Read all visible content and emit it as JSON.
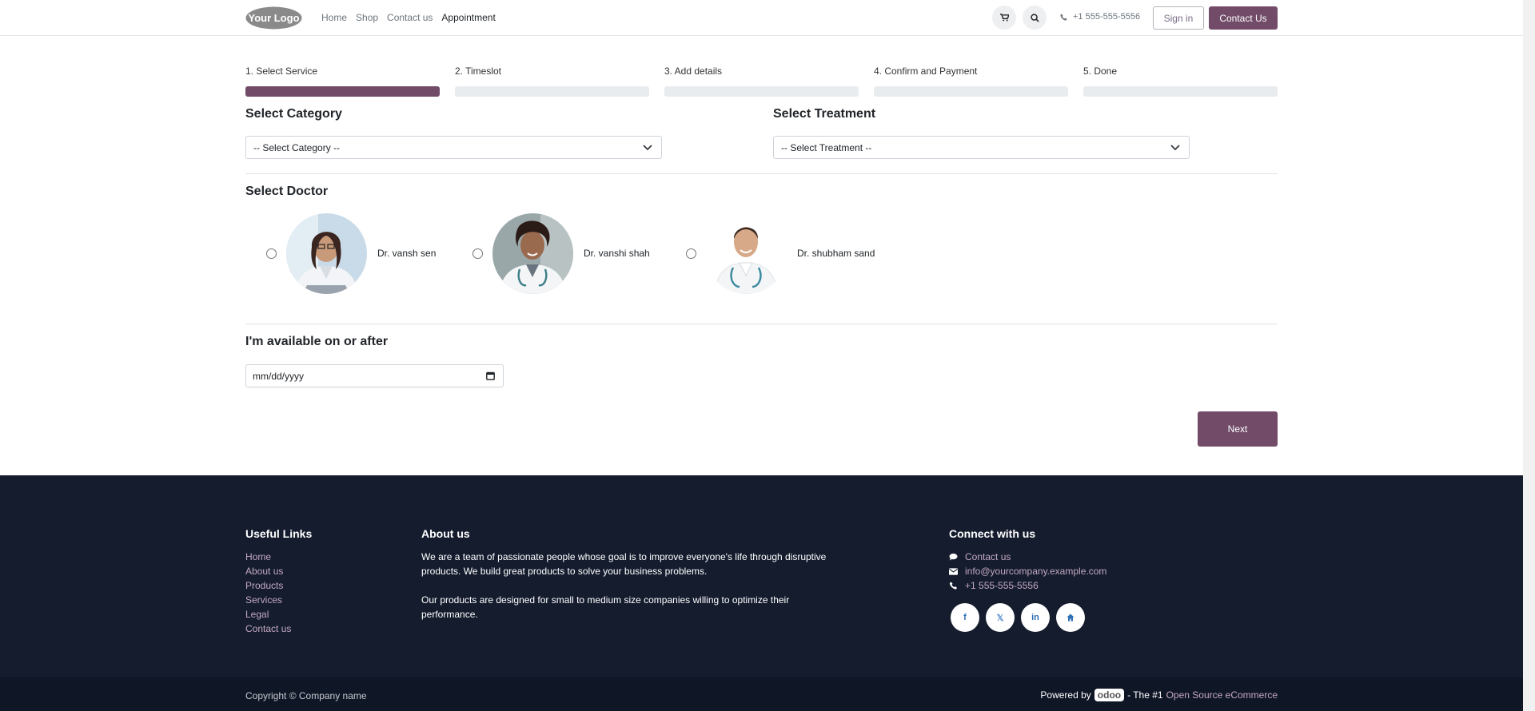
{
  "header": {
    "logo_text": "Your Logo",
    "nav": [
      "Home",
      "Shop",
      "Contact us",
      "Appointment"
    ],
    "active_nav": "Appointment",
    "phone": "+1 555-555-5556",
    "sign_in": "Sign in",
    "contact_button": "Contact Us"
  },
  "steps": [
    {
      "label": "1. Select Service",
      "active": true
    },
    {
      "label": "2. Timeslot",
      "active": false
    },
    {
      "label": "3. Add details",
      "active": false
    },
    {
      "label": "4. Confirm and Payment",
      "active": false
    },
    {
      "label": "5. Done",
      "active": false
    }
  ],
  "category": {
    "heading": "Select Category",
    "value": "-- Select Category --"
  },
  "treatment": {
    "heading": "Select Treatment",
    "value": "-- Select Treatment --"
  },
  "doctors": {
    "heading": "Select Doctor",
    "items": [
      {
        "name": "Dr. vansh sen"
      },
      {
        "name": "Dr. vanshi shah"
      },
      {
        "name": "Dr. shubham sand"
      }
    ]
  },
  "availability": {
    "heading": "I'm available on or after",
    "placeholder": "mm/dd/yyyy"
  },
  "next_button": "Next",
  "footer": {
    "useful_links_heading": "Useful Links",
    "useful_links": [
      "Home",
      "About us",
      "Products",
      "Services",
      "Legal",
      "Contact us"
    ],
    "about_heading": "About us",
    "about_p1": "We are a team of passionate people whose goal is to improve everyone's life through disruptive products. We build great products to solve your business problems.",
    "about_p2": "Our products are designed for small to medium size companies willing to optimize their performance.",
    "connect_heading": "Connect with us",
    "connect_contact": "Contact us",
    "connect_email": "info@yourcompany.example.com",
    "connect_phone": "+1 555-555-5556"
  },
  "copyright": {
    "left": "Copyright © Company name",
    "powered_by": "Powered by",
    "odoo": "odoo",
    "tagline": "- The #1",
    "link": "Open Source eCommerce"
  },
  "colors": {
    "accent": "#714b67",
    "footer_bg": "#141c2e"
  }
}
